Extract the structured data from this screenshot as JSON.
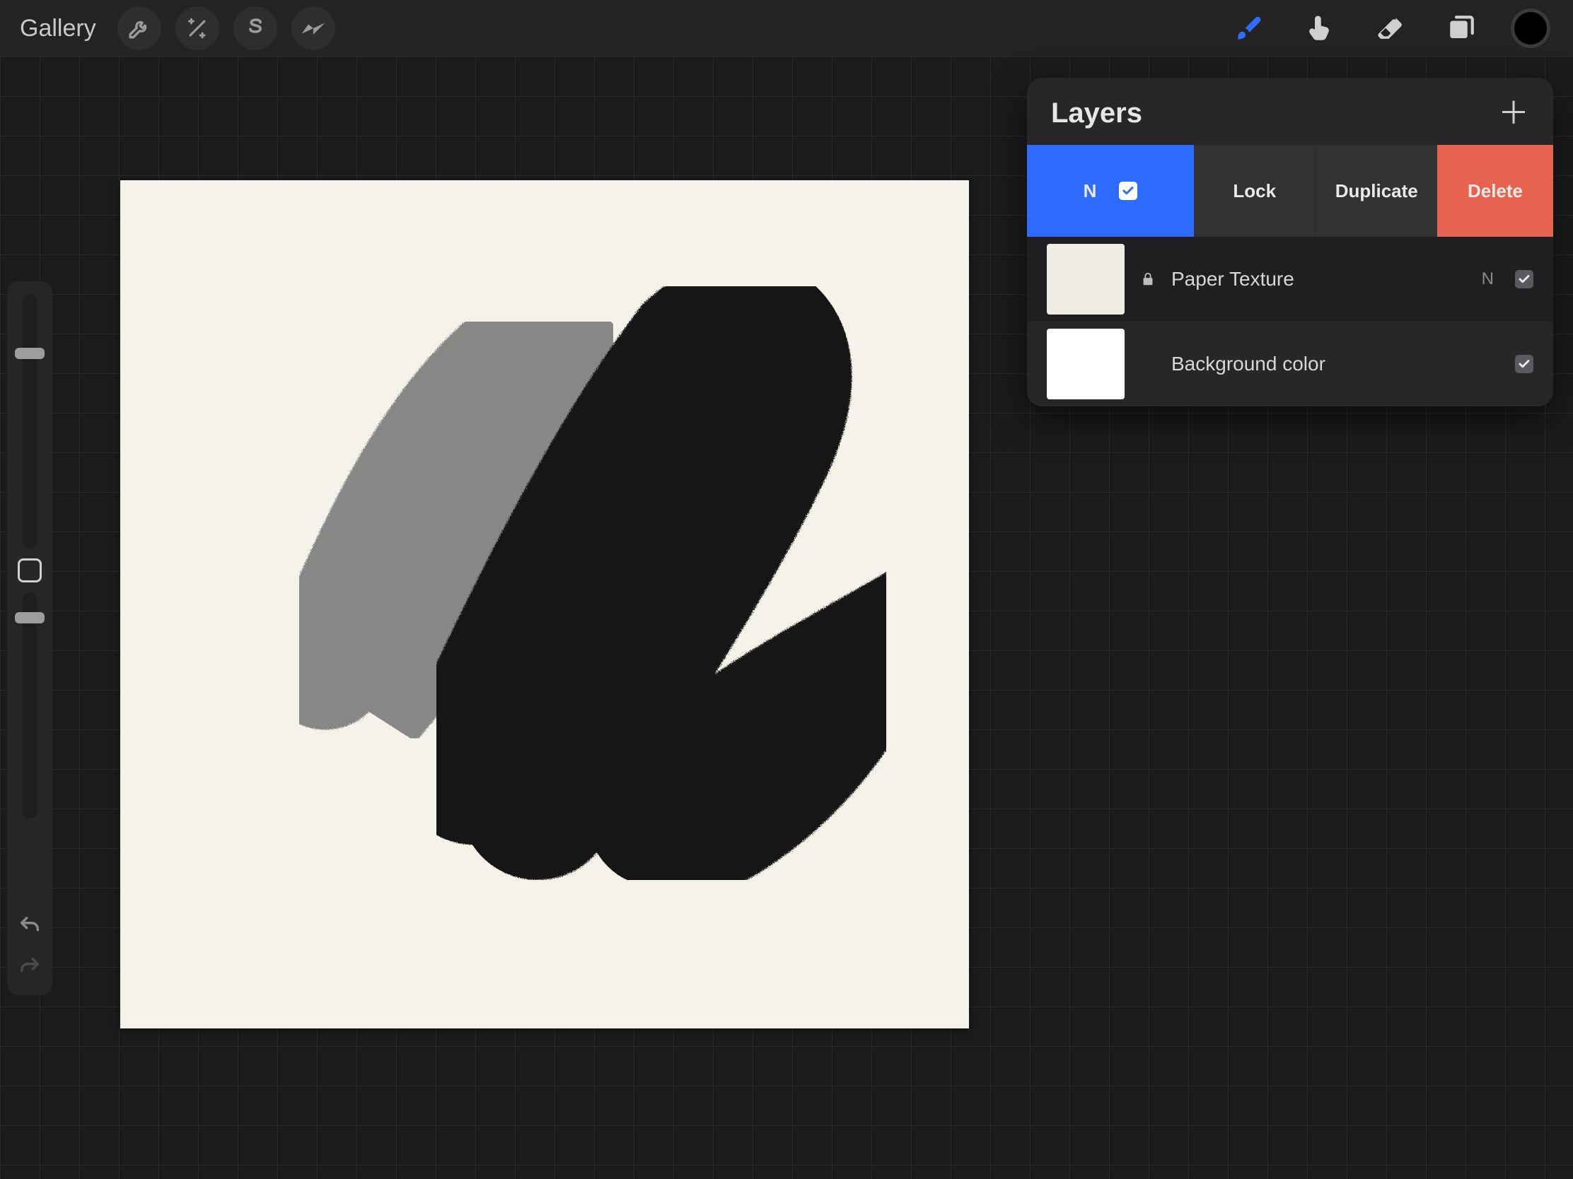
{
  "toolbar": {
    "gallery_label": "Gallery"
  },
  "layers_panel": {
    "title": "Layers",
    "swipe_actions": {
      "blend_mode_letter": "N",
      "lock": "Lock",
      "duplicate": "Duplicate",
      "delete": "Delete"
    },
    "layers": [
      {
        "name": "Paper Texture",
        "locked": true,
        "blend_letter": "N",
        "visible": true,
        "thumb": "paper"
      },
      {
        "name": "Background color",
        "locked": false,
        "blend_letter": "",
        "visible": true,
        "thumb": "white"
      }
    ]
  },
  "colors": {
    "accent": "#2e6bff",
    "danger": "#e6644f",
    "current_color": "#000000"
  },
  "sidebar": {
    "brush_size_percent": 22,
    "opacity_percent": 10
  }
}
